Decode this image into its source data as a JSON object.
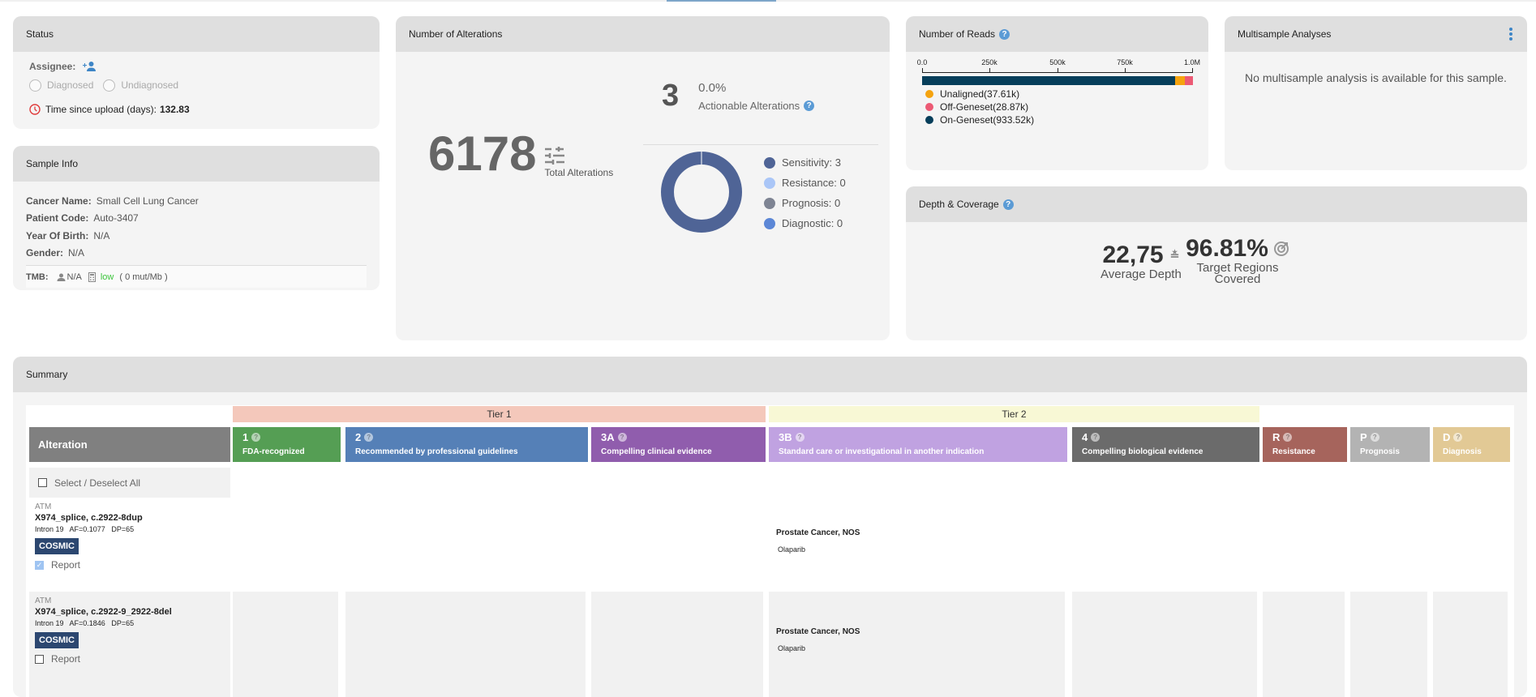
{
  "status": {
    "title": "Status",
    "assignee_label": "Assignee:",
    "radio_options": [
      "Diagnosed",
      "Undiagnosed"
    ],
    "time_label": "Time since upload (days):",
    "time_value": "132.83"
  },
  "sample_info": {
    "title": "Sample Info",
    "fields": [
      {
        "key": "Cancer Name:",
        "value": "Small Cell Lung Cancer"
      },
      {
        "key": "Patient Code:",
        "value": "Auto-3407"
      },
      {
        "key": "Year Of Birth:",
        "value": "N/A"
      },
      {
        "key": "Gender:",
        "value": "N/A"
      }
    ],
    "tmb": {
      "label": "TMB:",
      "person_value": "N/A",
      "level": "low",
      "value_text": "( 0 mut/Mb )"
    }
  },
  "alterations": {
    "title": "Number of Alterations",
    "total": "6178",
    "total_label": "Total Alterations",
    "actionable_count": "3",
    "actionable_pct": "0.0%",
    "actionable_label": "Actionable Alterations",
    "breakdown": [
      {
        "label": "Sensitivity: 3",
        "value": 3,
        "color": "#4f6496"
      },
      {
        "label": "Resistance: 0",
        "value": 0,
        "color": "#aac6f7"
      },
      {
        "label": "Prognosis: 0",
        "value": 0,
        "color": "#7e8493"
      },
      {
        "label": "Diagnostic: 0",
        "value": 0,
        "color": "#5c87d6"
      }
    ]
  },
  "reads": {
    "title": "Number of Reads",
    "axis_ticks": [
      "0.0",
      "250k",
      "500k",
      "750k",
      "1.0M"
    ],
    "axis_max": 1000000,
    "segments": [
      {
        "label": "Unaligned(37.61k)",
        "value": 37610,
        "color": "#f5a30f"
      },
      {
        "label": "Off-Geneset(28.87k)",
        "value": 28870,
        "color": "#ec5a74"
      },
      {
        "label": "On-Geneset(933.52k)",
        "value": 933520,
        "color": "#063e5a"
      }
    ]
  },
  "multisample": {
    "title": "Multisample Analyses",
    "message": "No multisample analysis is available for this sample."
  },
  "depth": {
    "title": "Depth & Coverage",
    "avg_depth": "22,75",
    "avg_depth_label": "Average Depth",
    "coverage": "96.81%",
    "coverage_label": "Target Regions Covered"
  },
  "summary": {
    "title": "Summary",
    "tiers": [
      "Tier 1",
      "Tier 2"
    ],
    "alteration_header": "Alteration",
    "select_all_label": "Select / Deselect All",
    "columns": [
      {
        "code": "1",
        "desc": "FDA-recognized",
        "color": "#559e54"
      },
      {
        "code": "2",
        "desc": "Recommended by professional guidelines",
        "color": "#5580b7"
      },
      {
        "code": "3A",
        "desc": "Compelling clinical evidence",
        "color": "#905dad"
      },
      {
        "code": "3B",
        "desc": "Standard care or investigational in another indication",
        "color": "#c0a2e1"
      },
      {
        "code": "4",
        "desc": "Compelling biological evidence",
        "color": "#6b6b6b"
      },
      {
        "code": "R",
        "desc": "Resistance",
        "color": "#a6645c"
      },
      {
        "code": "P",
        "desc": "Prognosis",
        "color": "#b3b3b3"
      },
      {
        "code": "D",
        "desc": "Diagnosis",
        "color": "#e2c995"
      }
    ],
    "rows": [
      {
        "gene": "ATM",
        "name": "X974_splice, c.2922-8dup",
        "meta": "Intron 19   AF=0.1077   DP=65",
        "badge": "COSMIC",
        "report_label": "Report",
        "report_checked": true,
        "indication": "Prostate Cancer, NOS",
        "drug": "Olaparib"
      },
      {
        "gene": "ATM",
        "name": "X974_splice, c.2922-9_2922-8del",
        "meta": "Intron 19   AF=0.1846   DP=65",
        "badge": "COSMIC",
        "report_label": "Report",
        "report_checked": false,
        "indication": "Prostate Cancer, NOS",
        "drug": "Olaparib"
      }
    ]
  }
}
